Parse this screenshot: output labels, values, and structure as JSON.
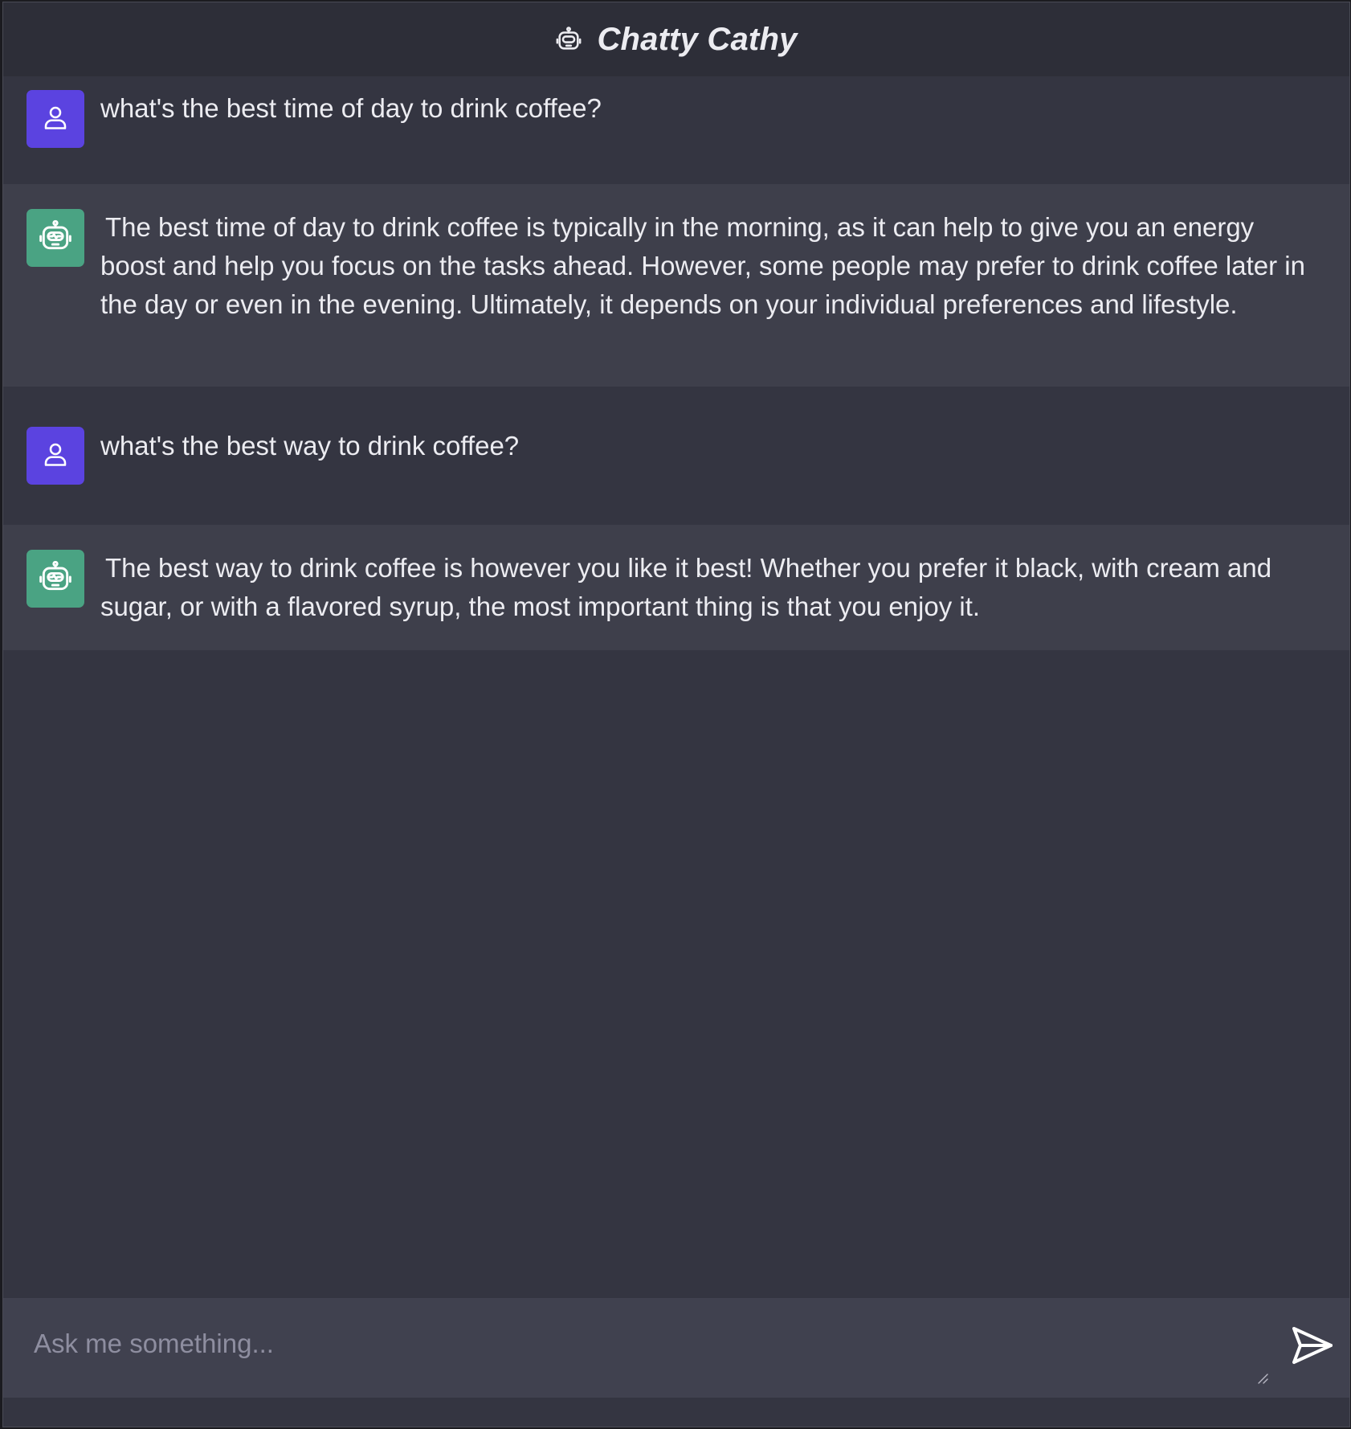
{
  "header": {
    "title": "Chatty Cathy",
    "icon": "robot-icon"
  },
  "messages": [
    {
      "role": "user",
      "avatar_icon": "user-icon",
      "text": "what's the best time of day to drink coffee?"
    },
    {
      "role": "bot",
      "avatar_icon": "robot-icon",
      "text": "The best time of day to drink coffee is typically in the morning, as it can help to give you an energy boost and help you focus on the tasks ahead. However, some people may prefer to drink coffee later in the day or even in the evening. Ultimately, it depends on your individual preferences and lifestyle."
    },
    {
      "role": "user",
      "avatar_icon": "user-icon",
      "text": "what's the best way to drink coffee?"
    },
    {
      "role": "bot",
      "avatar_icon": "robot-icon",
      "text": "The best way to drink coffee is however you like it best! Whether you prefer it black, with cream and sugar, or with a flavored syrup, the most important thing is that you enjoy it."
    }
  ],
  "input": {
    "placeholder": "Ask me something...",
    "value": "",
    "send_icon": "send-icon"
  },
  "colors": {
    "background": "#343541",
    "header": "#2d2e38",
    "bot_message": "#3e3f4b",
    "user_avatar": "#5b43e0",
    "bot_avatar": "#4aa383",
    "input_bar": "#40414f"
  }
}
